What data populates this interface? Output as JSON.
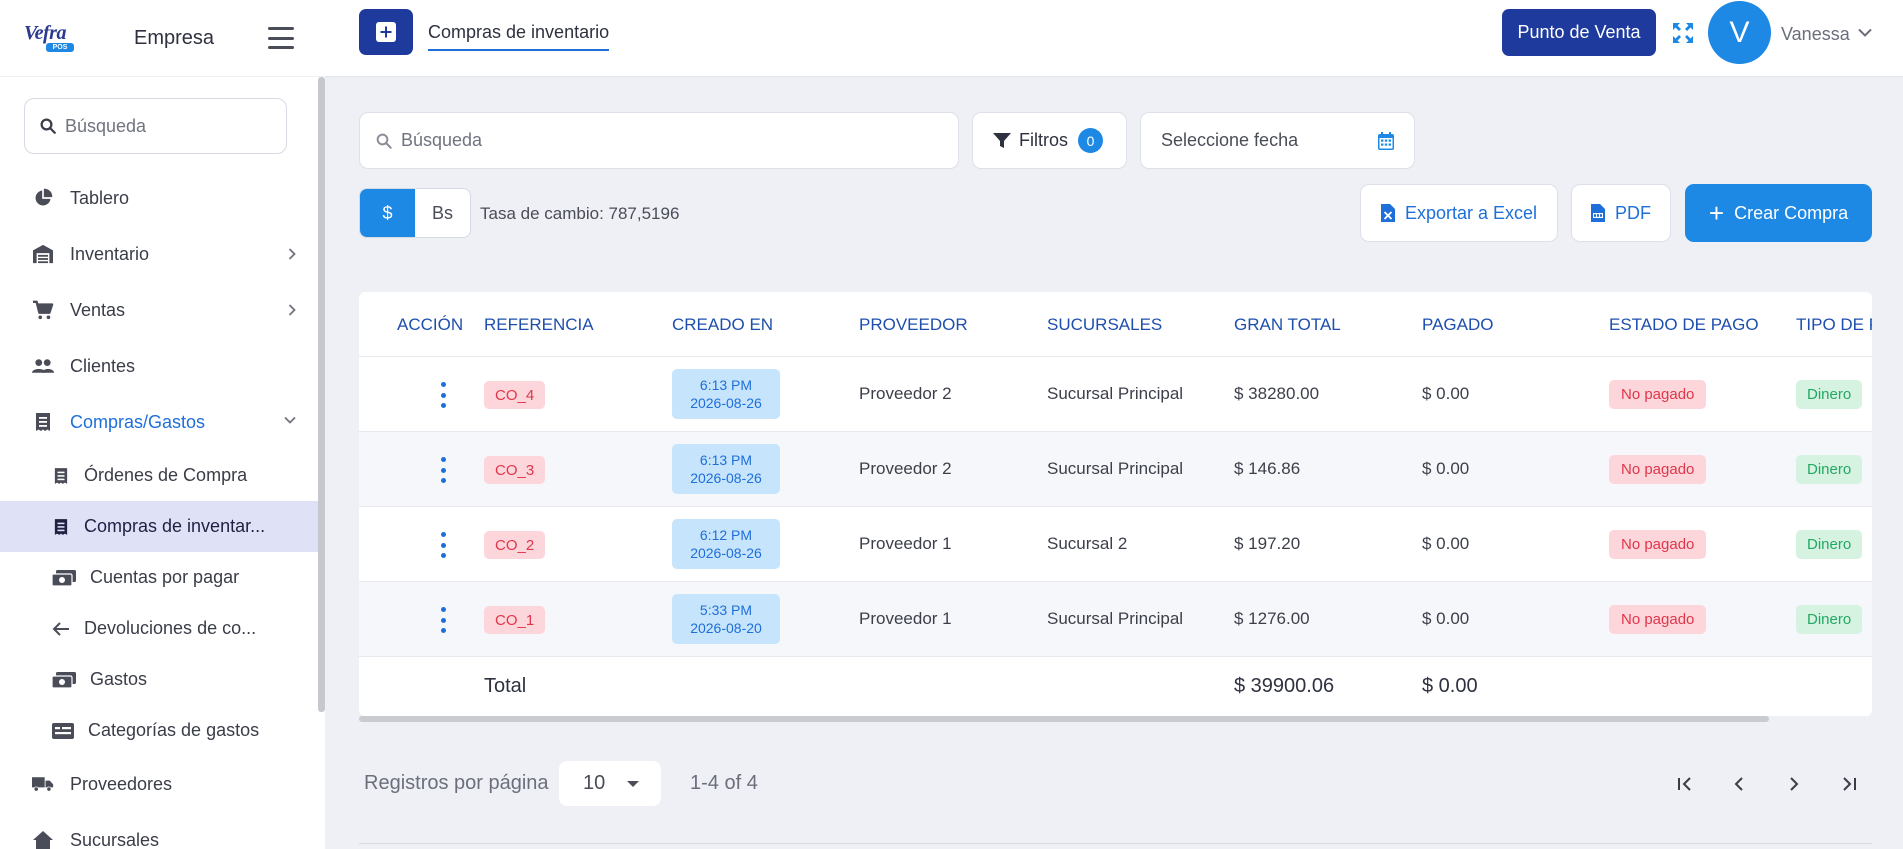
{
  "sidebar": {
    "logo_text": "Vefra",
    "logo_badge": "POS",
    "company": "Empresa",
    "search_placeholder": "Búsqueda",
    "items": [
      {
        "label": "Tablero"
      },
      {
        "label": "Inventario"
      },
      {
        "label": "Ventas"
      },
      {
        "label": "Clientes"
      },
      {
        "label": "Compras/Gastos"
      },
      {
        "label": "Proveedores"
      },
      {
        "label": "Sucursales"
      }
    ],
    "sub_items": [
      {
        "label": "Órdenes de Compra"
      },
      {
        "label": "Compras de inventar..."
      },
      {
        "label": "Cuentas por pagar"
      },
      {
        "label": "Devoluciones de co..."
      },
      {
        "label": "Gastos"
      },
      {
        "label": "Categorías de gastos"
      }
    ]
  },
  "topbar": {
    "page_tab": "Compras de inventario",
    "pos_button": "Punto de Venta",
    "avatar_letter": "V",
    "user_name": "Vanessa"
  },
  "toolbar": {
    "search_placeholder": "Búsqueda",
    "filters_label": "Filtros",
    "filters_count": "0",
    "date_placeholder": "Seleccione fecha",
    "currency_usd": "$",
    "currency_bs": "Bs",
    "exchange_rate": "Tasa de cambio: 787,5196",
    "excel_label": "Exportar a Excel",
    "pdf_label": "PDF",
    "create_label": "Crear Compra"
  },
  "table": {
    "columns": [
      "ACCIÓN",
      "REFERENCIA",
      "CREADO EN",
      "PROVEEDOR",
      "SUCURSALES",
      "GRAN TOTAL",
      "PAGADO",
      "ESTADO DE PAGO",
      "TIPO DE P"
    ],
    "rows": [
      {
        "ref": "CO_4",
        "time": "6:13 PM",
        "date": "2026-08-26",
        "supplier": "Proveedor 2",
        "branch": "Sucursal Principal",
        "total": "$ 38280.00",
        "paid": "$ 0.00",
        "status": "No pagado",
        "type": "Dinero"
      },
      {
        "ref": "CO_3",
        "time": "6:13 PM",
        "date": "2026-08-26",
        "supplier": "Proveedor 2",
        "branch": "Sucursal Principal",
        "total": "$ 146.86",
        "paid": "$ 0.00",
        "status": "No pagado",
        "type": "Dinero"
      },
      {
        "ref": "CO_2",
        "time": "6:12 PM",
        "date": "2026-08-26",
        "supplier": "Proveedor 1",
        "branch": "Sucursal 2",
        "total": "$ 197.20",
        "paid": "$ 0.00",
        "status": "No pagado",
        "type": "Dinero"
      },
      {
        "ref": "CO_1",
        "time": "5:33 PM",
        "date": "2026-08-20",
        "supplier": "Proveedor 1",
        "branch": "Sucursal Principal",
        "total": "$ 1276.00",
        "paid": "$ 0.00",
        "status": "No pagado",
        "type": "Dinero"
      }
    ],
    "total_label": "Total",
    "total_grand": "$ 39900.06",
    "total_paid": "$ 0.00"
  },
  "pagination": {
    "per_page_label": "Registros por página",
    "per_page_value": "10",
    "range": "1-4 of 4"
  },
  "colors": {
    "primary_dark": "#1e3a9c",
    "primary": "#1e88e5",
    "danger_bg": "#fcd6da",
    "success_bg": "#d6f3e2"
  },
  "icons": {
    "search": "search-icon",
    "filter": "filter-icon",
    "calendar": "calendar-icon",
    "excel": "excel-file-icon",
    "pdf": "pdf-file-icon",
    "expand": "fullscreen-icon"
  }
}
